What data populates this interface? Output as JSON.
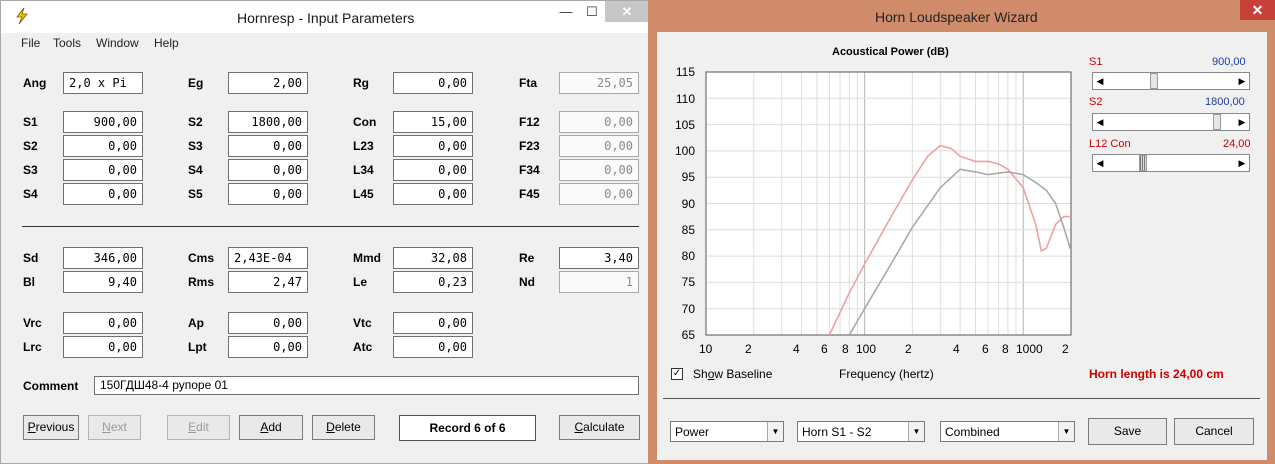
{
  "left_window": {
    "title": "Hornresp - Input Parameters",
    "controls": {
      "minimize": "—",
      "maximize": "☐",
      "close": "✕"
    },
    "menu": [
      "File",
      "Tools",
      "Window",
      "Help"
    ],
    "params": {
      "Ang": {
        "label": "Ang",
        "value": "2,0 x Pi"
      },
      "Eg": {
        "label": "Eg",
        "value": "2,00"
      },
      "Rg": {
        "label": "Rg",
        "value": "0,00"
      },
      "Fta": {
        "label": "Fta",
        "value": "25,05"
      },
      "S1": {
        "label": "S1",
        "value": "900,00"
      },
      "S2": {
        "label": "S2",
        "value": "1800,00"
      },
      "Con": {
        "label": "Con",
        "value": "15,00"
      },
      "F12": {
        "label": "F12",
        "value": "0,00"
      },
      "S2b": {
        "label": "S2",
        "value": "0,00"
      },
      "S3": {
        "label": "S3",
        "value": "0,00"
      },
      "L23": {
        "label": "L23",
        "value": "0,00"
      },
      "F23": {
        "label": "F23",
        "value": "0,00"
      },
      "S3b": {
        "label": "S3",
        "value": "0,00"
      },
      "S4": {
        "label": "S4",
        "value": "0,00"
      },
      "L34": {
        "label": "L34",
        "value": "0,00"
      },
      "F34": {
        "label": "F34",
        "value": "0,00"
      },
      "S4b": {
        "label": "S4",
        "value": "0,00"
      },
      "S5": {
        "label": "S5",
        "value": "0,00"
      },
      "L45": {
        "label": "L45",
        "value": "0,00"
      },
      "F45": {
        "label": "F45",
        "value": "0,00"
      },
      "Sd": {
        "label": "Sd",
        "value": "346,00"
      },
      "Cms": {
        "label": "Cms",
        "value": "2,43E-04"
      },
      "Mmd": {
        "label": "Mmd",
        "value": "32,08"
      },
      "Re": {
        "label": "Re",
        "value": "3,40"
      },
      "Bl": {
        "label": "Bl",
        "value": "9,40"
      },
      "Rms": {
        "label": "Rms",
        "value": "2,47"
      },
      "Le": {
        "label": "Le",
        "value": "0,23"
      },
      "Nd": {
        "label": "Nd",
        "value": "1"
      },
      "Vrc": {
        "label": "Vrc",
        "value": "0,00"
      },
      "Ap": {
        "label": "Ap",
        "value": "0,00"
      },
      "Vtc": {
        "label": "Vtc",
        "value": "0,00"
      },
      "Lrc": {
        "label": "Lrc",
        "value": "0,00"
      },
      "Lpt": {
        "label": "Lpt",
        "value": "0,00"
      },
      "Atc": {
        "label": "Atc",
        "value": "0,00"
      }
    },
    "comment_label": "Comment",
    "comment_value": "150ГДШ48-4 рупоре 01",
    "buttons": {
      "previous": "Previous",
      "next": "Next",
      "edit": "Edit",
      "add": "Add",
      "delete": "Delete",
      "calculate": "Calculate"
    },
    "record": "Record 6 of 6"
  },
  "right_window": {
    "title": "Horn Loudspeaker Wizard",
    "controls": {
      "close": "✕"
    },
    "s1_label": "S1",
    "s1_value": "900,00",
    "s1_level": 0.36,
    "s2_label": "S2",
    "s2_value": "1800,00",
    "s2_level": 0.88,
    "l12_label": "L12  Con",
    "l12_value": "24,00",
    "l12_level": 0.27,
    "show_baseline_label": "Show Baseline",
    "show_baseline_checked": true,
    "horn_length": "Horn length is 24,00 cm",
    "combo_power": "Power",
    "combo_horn": "Horn S1 - S2",
    "combo_combined": "Combined",
    "save_button": "Save",
    "cancel_button": "Cancel"
  },
  "chart_data": {
    "type": "line",
    "title": "Acoustical Power (dB)",
    "xlabel": "Frequency (hertz)",
    "ylabel": "",
    "xscale": "log",
    "xlim": [
      10,
      2000
    ],
    "ylim": [
      65,
      115
    ],
    "grid": true,
    "y_ticks": [
      "115",
      "110",
      "105",
      "100",
      "95",
      "90",
      "85",
      "80",
      "75",
      "70",
      "65"
    ],
    "x_ticks": [
      "10",
      "2",
      "4",
      "6",
      "8",
      "100",
      "2",
      "4",
      "6",
      "8",
      "1000",
      "2"
    ],
    "series": [
      {
        "color": "#f0a0a0",
        "x": [
          60,
          80,
          100,
          150,
          200,
          250,
          300,
          350,
          400,
          500,
          600,
          700,
          800,
          1000,
          1200,
          1300,
          1400,
          1600,
          1800,
          2000
        ],
        "y": [
          65,
          73,
          78.5,
          88,
          94.5,
          99,
          101,
          100.5,
          99,
          98,
          98,
          97.5,
          96.5,
          93,
          86,
          81,
          81.5,
          86,
          87.5,
          87.5
        ]
      },
      {
        "color": "#a9a9a9",
        "x": [
          80,
          100,
          150,
          200,
          300,
          400,
          500,
          600,
          800,
          1000,
          1200,
          1400,
          1600,
          1800,
          2000
        ],
        "y": [
          65,
          70,
          79,
          85.5,
          93,
          96.5,
          96,
          95.5,
          96,
          95.5,
          94,
          92.5,
          90,
          85.5,
          81
        ]
      }
    ]
  }
}
